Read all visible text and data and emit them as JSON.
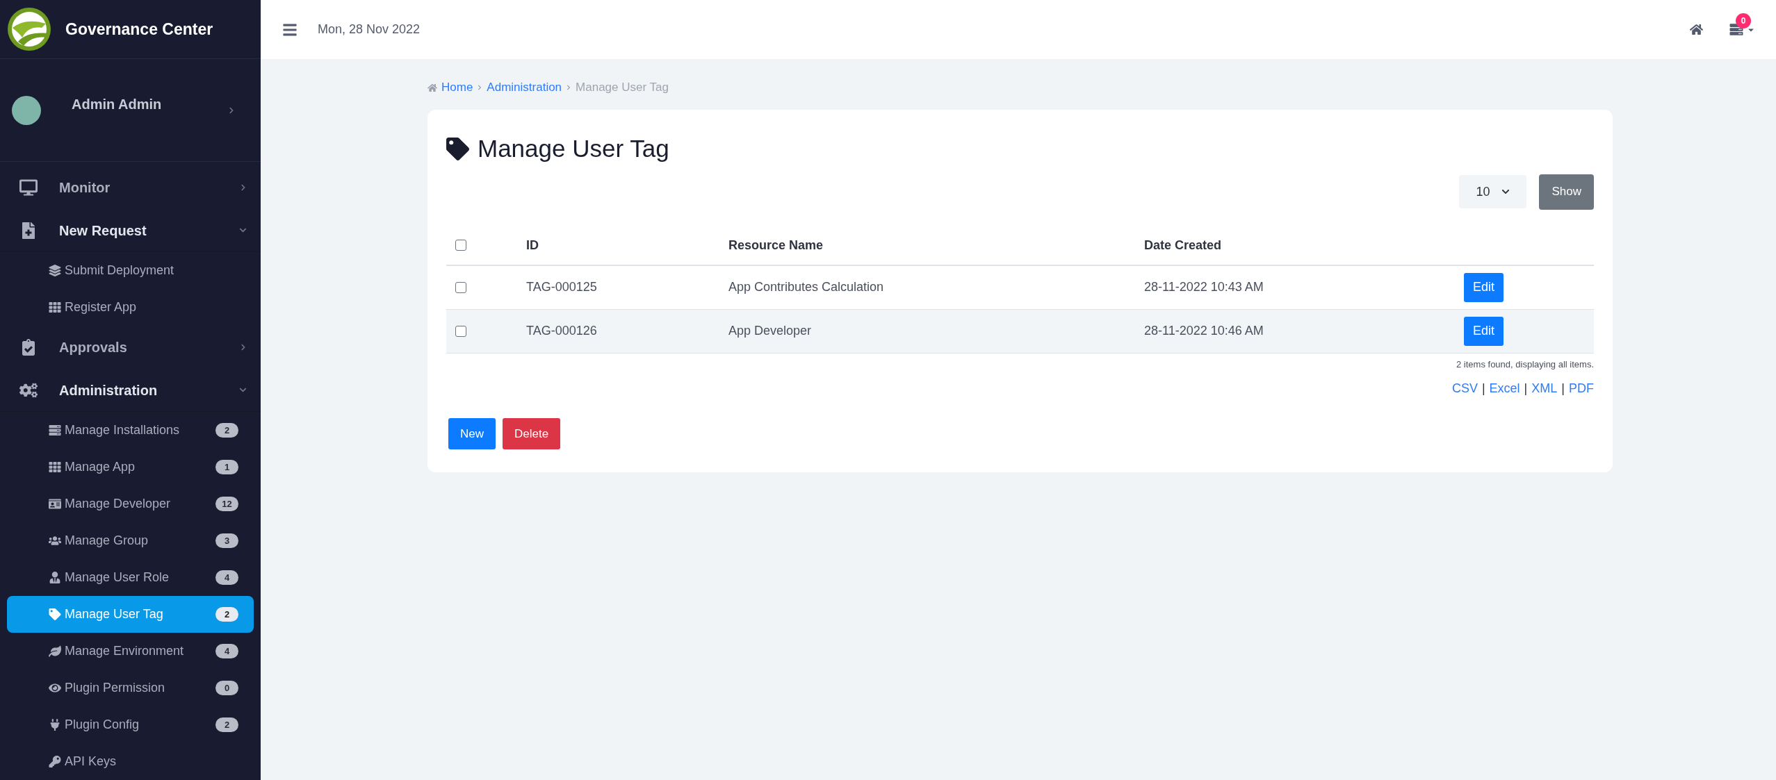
{
  "app": {
    "title": "Governance Center"
  },
  "user": {
    "name": "Admin Admin"
  },
  "topbar": {
    "date": "Mon, 28 Nov 2022",
    "notification_count": "0"
  },
  "sidebar": {
    "items": [
      {
        "label": "Monitor",
        "expanded": false
      },
      {
        "label": "New Request",
        "expanded": true,
        "children": [
          {
            "label": "Submit Deployment",
            "selected": false
          },
          {
            "label": "Register App",
            "selected": false
          }
        ]
      },
      {
        "label": "Approvals",
        "expanded": false
      },
      {
        "label": "Administration",
        "expanded": true,
        "children": [
          {
            "label": "Manage Installations",
            "badge": "2",
            "selected": false
          },
          {
            "label": "Manage App",
            "badge": "1",
            "selected": false
          },
          {
            "label": "Manage Developer",
            "badge": "12",
            "selected": false
          },
          {
            "label": "Manage Group",
            "badge": "3",
            "selected": false
          },
          {
            "label": "Manage User Role",
            "badge": "4",
            "selected": false
          },
          {
            "label": "Manage User Tag",
            "badge": "2",
            "selected": true
          },
          {
            "label": "Manage Environment",
            "badge": "4",
            "selected": false
          },
          {
            "label": "Plugin Permission",
            "badge": "0",
            "selected": false
          },
          {
            "label": "Plugin Config",
            "badge": "2",
            "selected": false
          },
          {
            "label": "API Keys",
            "selected": false
          }
        ]
      }
    ]
  },
  "breadcrumb": [
    {
      "label": "Home",
      "current": false
    },
    {
      "label": "Administration",
      "current": false
    },
    {
      "label": "Manage User Tag",
      "current": true
    }
  ],
  "page": {
    "title": "Manage User Tag",
    "per_page": "10",
    "show_button": "Show"
  },
  "table": {
    "header_checked": false,
    "columns": [
      "ID",
      "Resource Name",
      "Date Created"
    ],
    "rows": [
      {
        "checked": false,
        "id": "TAG-000125",
        "resource_name": "App Contributes Calculation",
        "date_created": "28-11-2022 10:43 AM",
        "action": "Edit"
      },
      {
        "checked": false,
        "id": "TAG-000126",
        "resource_name": "App Developer",
        "date_created": "28-11-2022 10:46 AM",
        "action": "Edit"
      }
    ]
  },
  "summary": "2 items found, displaying all items.",
  "exports": {
    "separator": "|",
    "links": [
      "CSV",
      "Excel",
      "XML",
      "PDF"
    ]
  },
  "buttons": [
    {
      "label": "New",
      "kind": "primary"
    },
    {
      "label": "Delete",
      "kind": "danger"
    }
  ]
}
